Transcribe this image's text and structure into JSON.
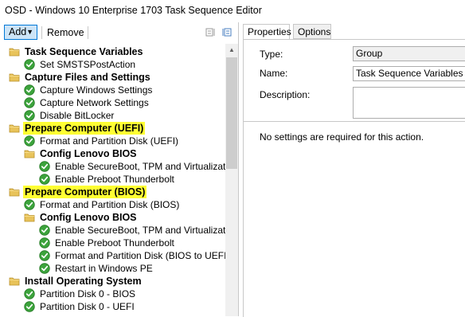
{
  "window": {
    "title": "OSD - Windows 10 Enterprise 1703 Task Sequence Editor"
  },
  "toolbar": {
    "add_label": "Add",
    "remove_label": "Remove"
  },
  "tree": {
    "items": [
      {
        "label": "Task Sequence Variables",
        "type": "group",
        "level": 0,
        "highlight": false
      },
      {
        "label": "Set SMSTSPostAction",
        "type": "step",
        "level": 1,
        "highlight": false
      },
      {
        "label": "Capture Files and Settings",
        "type": "group",
        "level": 0,
        "highlight": false
      },
      {
        "label": "Capture Windows Settings",
        "type": "step",
        "level": 1,
        "highlight": false
      },
      {
        "label": "Capture Network Settings",
        "type": "step",
        "level": 1,
        "highlight": false
      },
      {
        "label": "Disable BitLocker",
        "type": "step",
        "level": 1,
        "highlight": false
      },
      {
        "label": "Prepare Computer (UEFI)",
        "type": "group",
        "level": 0,
        "highlight": true
      },
      {
        "label": "Format and Partition Disk (UEFI)",
        "type": "step",
        "level": 1,
        "highlight": false
      },
      {
        "label": "Config Lenovo BIOS",
        "type": "group",
        "level": 1,
        "highlight": false
      },
      {
        "label": "Enable SecureBoot, TPM and Virtualization",
        "type": "step",
        "level": 2,
        "highlight": false
      },
      {
        "label": "Enable Preboot Thunderbolt",
        "type": "step",
        "level": 2,
        "highlight": false
      },
      {
        "label": "Prepare Computer (BIOS)",
        "type": "group",
        "level": 0,
        "highlight": true
      },
      {
        "label": "Format and Partition Disk (BIOS)",
        "type": "step",
        "level": 1,
        "highlight": false
      },
      {
        "label": "Config Lenovo BIOS",
        "type": "group",
        "level": 1,
        "highlight": false
      },
      {
        "label": "Enable SecureBoot, TPM and Virtualization",
        "type": "step",
        "level": 2,
        "highlight": false
      },
      {
        "label": "Enable Preboot Thunderbolt",
        "type": "step",
        "level": 2,
        "highlight": false
      },
      {
        "label": "Format and Partition Disk (BIOS to UEFI)",
        "type": "step",
        "level": 2,
        "highlight": false
      },
      {
        "label": "Restart in Windows PE",
        "type": "step",
        "level": 2,
        "highlight": false
      },
      {
        "label": "Install Operating System",
        "type": "group",
        "level": 0,
        "highlight": false
      },
      {
        "label": "Partition Disk 0 - BIOS",
        "type": "step",
        "level": 1,
        "highlight": false
      },
      {
        "label": "Partition Disk 0 - UEFI",
        "type": "step",
        "level": 1,
        "highlight": false
      }
    ]
  },
  "tabs": [
    {
      "label": "Properties",
      "active": true
    },
    {
      "label": "Options",
      "active": false
    }
  ],
  "properties": {
    "type_label": "Type:",
    "type_value": "Group",
    "name_label": "Name:",
    "name_value": "Task Sequence Variables",
    "description_label": "Description:",
    "description_value": "",
    "note": "No settings are required  for this action."
  },
  "colors": {
    "highlight": "#ffff33",
    "accent": "#0078d7",
    "check_green": "#3ca33c",
    "folder_yellow": "#e8c35a"
  }
}
